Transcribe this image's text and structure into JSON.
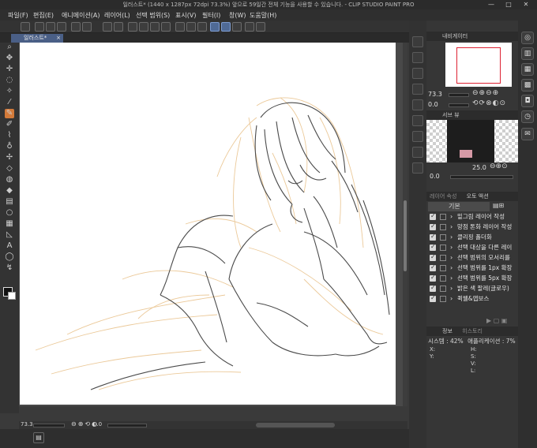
{
  "window": {
    "title": "일러스트* (1440 x 1287px 72dpi 73.3%)  앞으로 59일간 전체 기능을 사용할 수 있습니다. - CLIP STUDIO PAINT PRO",
    "minimize": "—",
    "maximize": "□",
    "close": "✕"
  },
  "menu": [
    "파일(F)",
    "편집(E)",
    "애니메이션(A)",
    "레이어(L)",
    "선택 범위(S)",
    "표시(V)",
    "필터(I)",
    "창(W)",
    "도움말(H)"
  ],
  "document_tab": {
    "label": "일러스트*",
    "close": "×"
  },
  "status": {
    "zoom": "73.3",
    "angle": "0.0"
  },
  "navigator": {
    "title": "내비게이터",
    "zoom": "73.3",
    "angle": "0.0"
  },
  "subview": {
    "title": "서브 뷰",
    "value": "25.0",
    "angle": "0.0"
  },
  "auto_action": {
    "tab_inactive": "레이어 속성",
    "tab_active": "오토 액션",
    "set_name": "기본",
    "items": [
      "밑그림 레이어 작성",
      "망점 톤화 레이어 작성",
      "클리핑 폴더화",
      "선택 대상을 다른 레이",
      "선택 범위의 모서리를",
      "선택 범위를 1px 확장",
      "선택 범위를 5px 확장",
      "밝은 색 팔레(글로우)",
      "퀵웰&앱보스"
    ]
  },
  "info": {
    "title": "정보",
    "tab2": "히스토리",
    "system_label": "시스템 : 42%",
    "app_label": "애플리케이션 : 7%",
    "x_label": "X:",
    "y_label": "Y:",
    "h_label": "H:",
    "s_label": "S:",
    "v_label": "V:",
    "l_label": "L:"
  },
  "colors": {
    "accent": "#4f6a96",
    "ui_bg": "#363636",
    "lineart_dark": "#4a4a4a",
    "sketch_orange": "#e8b868"
  }
}
